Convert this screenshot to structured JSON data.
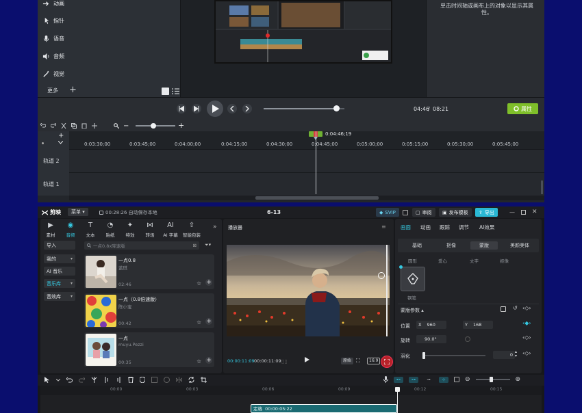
{
  "top_window": {
    "nav_items": [
      {
        "label": "动画",
        "icon": "animation-icon"
      },
      {
        "label": "指针",
        "icon": "cursor-icon"
      },
      {
        "label": "语音",
        "icon": "microphone-icon"
      },
      {
        "label": "音频",
        "icon": "speaker-icon"
      },
      {
        "label": "视觉",
        "icon": "magic-wand-icon"
      }
    ],
    "more_label": "更多",
    "props_hint": "单击时间轴或画布上的对象以显示其属性。",
    "time_current": "04:46",
    "time_separator": "/",
    "time_total": "08:21",
    "progress": 0.9,
    "properties_label": "属性",
    "playhead_time": "0:04:46;19",
    "ruler_ticks": [
      "0:03:30;00",
      "0:03:45;00",
      "0:04:00;00",
      "0:04:15;00",
      "0:04:30;00",
      "0:04:45;00",
      "0:05:00;00",
      "0:05:15;00",
      "0:05:30;00",
      "0:05:45;00"
    ],
    "tracks": [
      "轨道 2",
      "轨道 1"
    ]
  },
  "capcut": {
    "app_name": "剪映",
    "menu_label": "菜单",
    "autosave": "00:28:26 自动保存本地",
    "project_name": "6-13",
    "svip_label": "SVIP",
    "review_label": "审阅",
    "publish_label": "发布模板",
    "export_label": "导出",
    "media_tabs": [
      {
        "label": "素材",
        "icon": "media-icon"
      },
      {
        "label": "音频",
        "icon": "audio-icon",
        "active": true
      },
      {
        "label": "文本",
        "icon": "text-icon"
      },
      {
        "label": "贴纸",
        "icon": "sticker-icon"
      },
      {
        "label": "特效",
        "icon": "effects-icon"
      },
      {
        "label": "转场",
        "icon": "transition-icon"
      },
      {
        "label": "AI 字幕",
        "icon": "ai-caption-icon"
      },
      {
        "label": "智能包装",
        "icon": "smart-pack-icon"
      }
    ],
    "side_buttons": [
      {
        "label": "导入",
        "dropdown": false
      },
      {
        "label": "我的",
        "dropdown": true
      },
      {
        "label": "AI 音乐",
        "dropdown": false
      },
      {
        "label": "音乐库",
        "dropdown": true,
        "active": true
      },
      {
        "label": "音效库",
        "dropdown": true
      }
    ],
    "search_placeholder": "一点0.8x降速版",
    "songs": [
      {
        "title": "一点0.8",
        "artist": "蓝琪",
        "duration": "02:46"
      },
      {
        "title": "一点（0.8倍速版）",
        "artist": "陈小宝",
        "duration": "00:42"
      },
      {
        "title": "一点",
        "artist": "muyu.Pezzi",
        "duration": "00:35"
      }
    ],
    "player_label": "播放器",
    "player_time_current": "00:00:11:09",
    "player_time_total": "00:00:11:09",
    "player_mode": "原始",
    "player_ratio": "16:9",
    "inspector_tabs": [
      {
        "label": "画面",
        "active": true
      },
      {
        "label": "动画"
      },
      {
        "label": "跟踪"
      },
      {
        "label": "调节"
      },
      {
        "label": "AI效果"
      }
    ],
    "sub_tabs": [
      {
        "label": "基础"
      },
      {
        "label": "抠像"
      },
      {
        "label": "蒙版",
        "active": true
      },
      {
        "label": "美颜美体"
      }
    ],
    "mask_types": [
      "圆形",
      "爱心",
      "文字",
      "抠像"
    ],
    "mask_selected_label": "钢笔",
    "mask_params_label": "蒙版参数",
    "position_label": "位置",
    "pos_x_label": "X",
    "pos_x": "960",
    "pos_y_label": "Y",
    "pos_y": "168",
    "rotation_label": "旋转",
    "rotation": "90.0°",
    "feather_label": "羽化",
    "feather": "0",
    "feather_value": 0,
    "ruler_ticks": [
      "00:00",
      "00:03",
      "00:06",
      "00:09",
      "00:12",
      "00:15"
    ],
    "clip_label": "定格",
    "clip_duration": "00:00:05:22",
    "accent": "#35c8e0"
  }
}
